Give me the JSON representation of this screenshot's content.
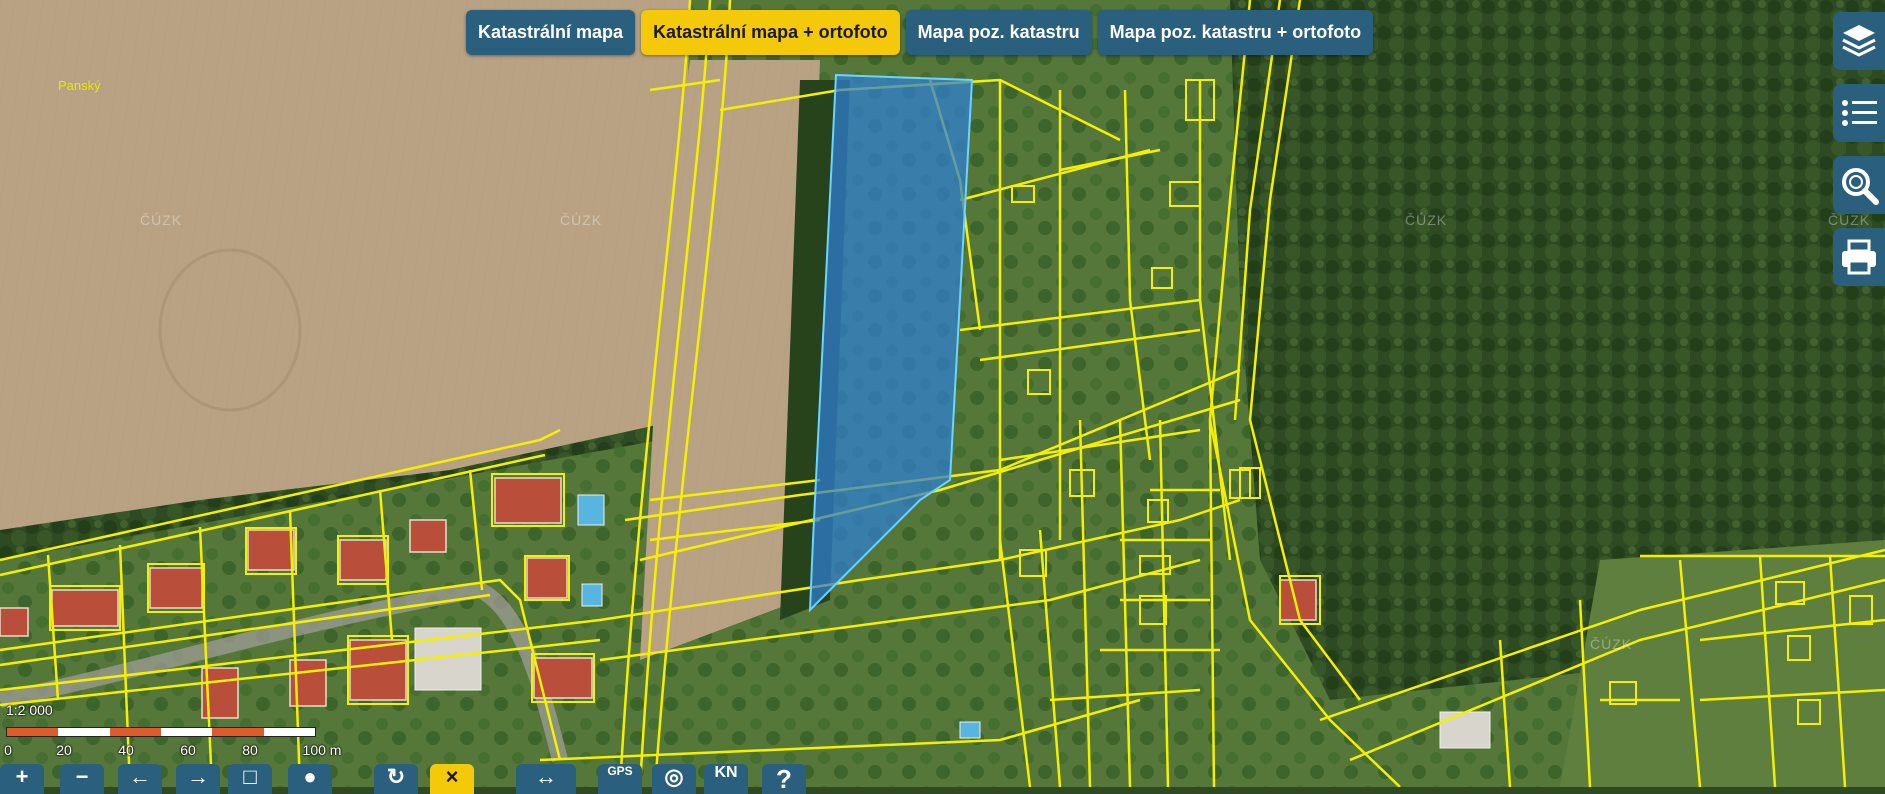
{
  "map_layers": {
    "tabs": [
      {
        "label": "Katastrální mapa",
        "active": false
      },
      {
        "label": "Katastrální mapa + ortofoto",
        "active": true
      },
      {
        "label": "Mapa poz. katastru",
        "active": false
      },
      {
        "label": "Mapa poz. katastru + ortofoto",
        "active": false
      }
    ]
  },
  "place_label": "Panský",
  "watermark": "ČÚZK",
  "scale": {
    "ratio_label": "1:2 000",
    "ticks": [
      "0",
      "20",
      "40",
      "60",
      "80",
      "100 m"
    ]
  },
  "right_toolbar": [
    {
      "icon": "layers-icon"
    },
    {
      "icon": "legend-list-icon"
    },
    {
      "icon": "search-zoom-icon"
    },
    {
      "icon": "print-icon"
    }
  ],
  "bottom_toolbar": [
    {
      "icon": "zoom-in-icon"
    },
    {
      "icon": "zoom-out-icon"
    },
    {
      "icon": "back-arrow-icon"
    },
    {
      "icon": "forward-arrow-icon"
    },
    {
      "icon": "zoom-rectangle-icon"
    },
    {
      "icon": "globe-icon"
    },
    {
      "icon": "rotate-icon"
    },
    {
      "icon": "cancel-icon"
    },
    {
      "icon": "measure-icon"
    },
    {
      "icon": "gps-icon",
      "label": "GPS"
    },
    {
      "icon": "locate-icon"
    },
    {
      "icon": "kn-icon",
      "label": "KN"
    },
    {
      "icon": "help-icon",
      "label": "?"
    }
  ],
  "colors": {
    "parcel_lines": "#f5f000",
    "selected_parcel": "#2f7fd6",
    "tab_bg": "#2a5f7e",
    "tab_active_bg": "#f3c90a"
  }
}
